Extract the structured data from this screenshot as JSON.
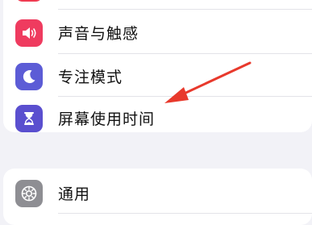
{
  "colors": {
    "page_background": "#f2f2f7",
    "card_background": "#ffffff",
    "separator": "#e3e3e8",
    "text": "#111111",
    "icon_red": "#ef3b51",
    "icon_sound": "#ef3b5f",
    "icon_focus": "#5c5cd6",
    "icon_screentime": "#5a4fcf",
    "icon_general": "#8e8e93",
    "annotation_arrow": "#e8392c"
  },
  "settings": {
    "group1": {
      "items": [
        {
          "label": "",
          "icon": "notifications-icon"
        },
        {
          "label": "声音与触感",
          "icon": "speaker-icon"
        },
        {
          "label": "专注模式",
          "icon": "moon-icon"
        },
        {
          "label": "屏幕使用时间",
          "icon": "hourglass-icon"
        }
      ]
    },
    "group2": {
      "items": [
        {
          "label": "通用",
          "icon": "gear-icon"
        }
      ]
    }
  },
  "annotation": {
    "type": "arrow",
    "target": "screen-time"
  }
}
